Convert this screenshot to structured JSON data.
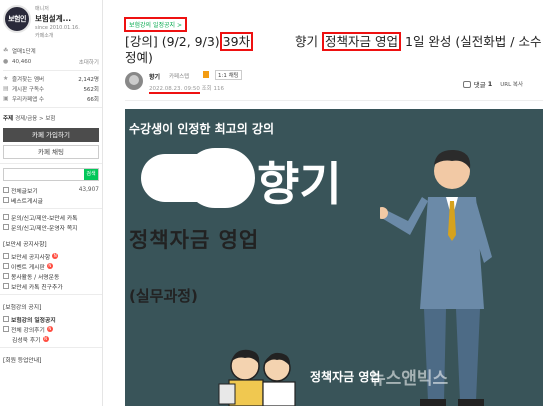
{
  "sidebar": {
    "manager_label": "매니저",
    "cafe_name": "보험설계...",
    "since": "since 2010.01.16.",
    "intro": "카페소개",
    "logo_text": "보험인",
    "grade": "열매1단계",
    "members": "40,460",
    "invite": "초대하기",
    "stats": [
      {
        "label": "즐겨찾는 멤버",
        "value": "2,142명"
      },
      {
        "label": "게시판 구독수",
        "value": "562회"
      },
      {
        "label": "우리카페앱 수",
        "value": "66회"
      }
    ],
    "subject_label": "주제",
    "subject_value": "경제/금융 > 보험",
    "join_button": "카페 가입하기",
    "chat_button": "카페 채팅",
    "search_go": "검색",
    "menu_group1": [
      {
        "label": "전체글보기",
        "count": "43,907"
      },
      {
        "label": "베스트게시글",
        "count": ""
      }
    ],
    "menu_group2": [
      {
        "label": "문의/신고/제안-보만세 카톡"
      },
      {
        "label": "문의/신고/제안-운영자 쪽지"
      }
    ],
    "notice_title": "[보만세 공지사항]",
    "notice_items": [
      {
        "label": "보만세 공지사항",
        "new": "N"
      },
      {
        "label": "이벤트 게시판",
        "new": "N"
      },
      {
        "label": "봉사활동 / 서명운동",
        "new": ""
      },
      {
        "label": "보만세 카톡 친구추가",
        "new": ""
      }
    ],
    "lecture_title": "[보험강의 공지]",
    "lecture_items": [
      {
        "label": "보험강의 일정공지",
        "new": "",
        "sub": false
      },
      {
        "label": "전체 강의후기",
        "new": "N",
        "sub": false
      },
      {
        "label": "김성욱 후기",
        "new": "N",
        "sub": true
      }
    ],
    "member_title": "[회원 등업안내]"
  },
  "post": {
    "board_link": "보험강의 일정공지 >",
    "title_prefix": "[강의] (9/2, 9/3)",
    "title_round": "39차",
    "title_mid": "향기",
    "title_subject": "정책자금 영업",
    "title_suffix": " 1일 완성 (실전화법 / 소수정예)",
    "author": "향기",
    "author_level": "카페스텝",
    "chat_label": "1:1 채팅",
    "date": "2022.08.23. 09:50",
    "views_label": "조회 116",
    "comment_label": "댓글",
    "comment_count": "1",
    "url_label": "URL 복사"
  },
  "banner": {
    "tagline": "수강생이 인정한 최고의 강의",
    "name": "향기",
    "subject": "정책자금 영업",
    "level": "(실무과정)",
    "bottom": "정책자금 영업",
    "watermark": "뉴스앤빅스",
    "bg_color": "#395459"
  }
}
